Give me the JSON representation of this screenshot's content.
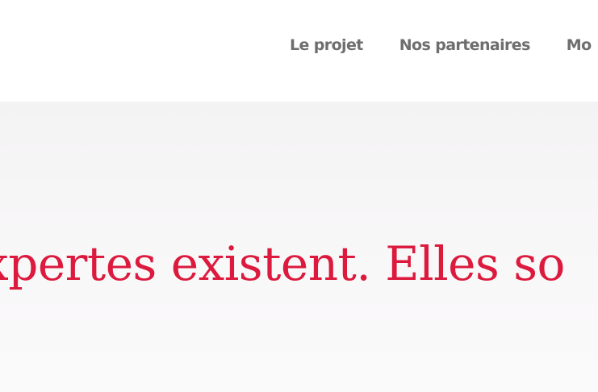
{
  "nav": {
    "items": [
      {
        "label": "Le projet"
      },
      {
        "label": "Nos partenaires"
      },
      {
        "label": "Mo"
      }
    ]
  },
  "hero": {
    "headline": "xpertes existent. Elles so"
  },
  "colors": {
    "accent": "#dc1a3e",
    "nav_text": "#6e6e6e",
    "hero_background": "#f6f5f6"
  }
}
